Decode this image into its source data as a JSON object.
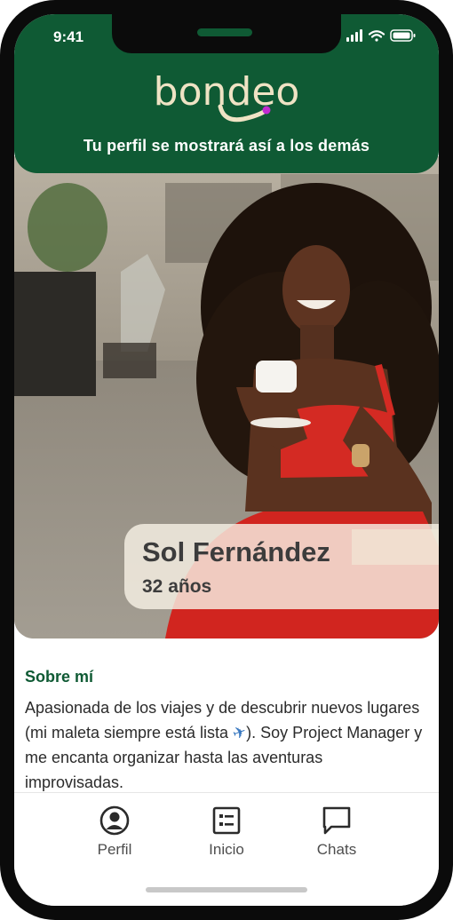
{
  "status_bar": {
    "time": "9:41"
  },
  "header": {
    "logo_text": "bondeo",
    "subtitle": "Tu  perfil se mostrará así a los demás"
  },
  "profile": {
    "name": "Sol Fernández",
    "age": "32 años"
  },
  "about": {
    "title": "Sobre mí",
    "text_before_icon": "Apasionada de los viajes y de descubrir nuevos lugares (mi maleta siempre está lista ",
    "icon_glyph": "✈",
    "text_after_icon": "). Soy Project Manager y me encanta organizar hasta las aventuras improvisadas."
  },
  "nav": {
    "items": [
      {
        "label": "Perfil",
        "icon": "profile-icon"
      },
      {
        "label": "Inicio",
        "icon": "list-icon"
      },
      {
        "label": "Chats",
        "icon": "chat-icon"
      }
    ]
  },
  "colors": {
    "brand_green": "#0f5a34",
    "logo_cream": "#efe3c4",
    "logo_dot": "#c12ad1"
  }
}
